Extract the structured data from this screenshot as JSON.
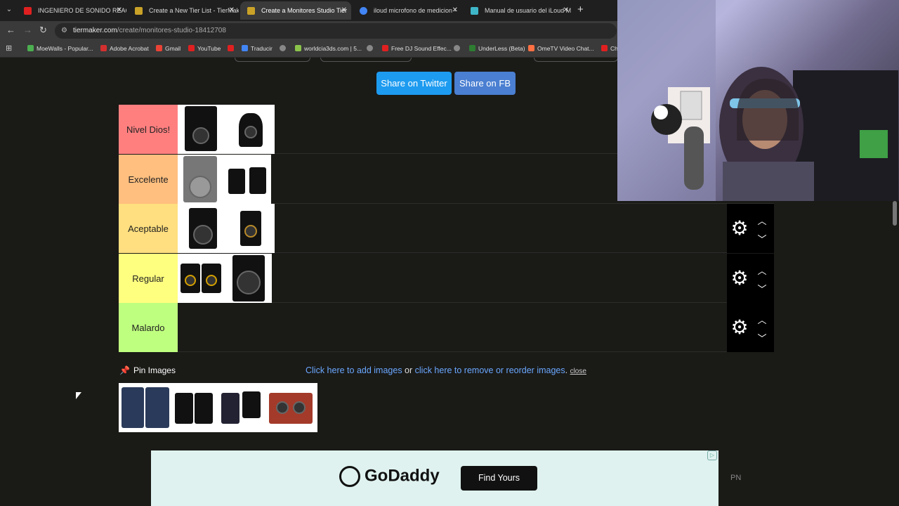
{
  "browser": {
    "tabs": [
      {
        "title": "INGENIERO DE SONIDO REACC",
        "color": "#e02020"
      },
      {
        "title": "Create a New Tier List - TierMak",
        "color": "#c9a227"
      },
      {
        "title": "Create a Monitores Studio Tier",
        "color": "#c9a227"
      },
      {
        "title": "iloud microfono de medicion -",
        "color": "#4285f4"
      },
      {
        "title": "Manual de usuario del iLoud M",
        "color": "#3fb6c8"
      }
    ],
    "url_host": "tiermaker.com",
    "url_path": "/create/monitores-studio-18412708",
    "bookmarks": [
      {
        "label": "MoeWalls - Popular...",
        "color": "#4caf50"
      },
      {
        "label": "Adobe Acrobat",
        "color": "#d32f2f"
      },
      {
        "label": "Gmail",
        "color": "#ea4335"
      },
      {
        "label": "YouTube",
        "color": "#e02020"
      },
      {
        "label": "",
        "color": "#e02020"
      },
      {
        "label": "Traducir",
        "color": "#4285f4"
      },
      {
        "label": "",
        "color": "#888888"
      },
      {
        "label": "worldcia3ds.com | 5...",
        "color": "#8bc34a"
      },
      {
        "label": "",
        "color": "#888888"
      },
      {
        "label": "Free DJ Sound Effec...",
        "color": "#e02020"
      },
      {
        "label": "",
        "color": "#888888"
      },
      {
        "label": "UnderLess (Beta)",
        "color": "#2e7d32"
      },
      {
        "label": "OmeTV Video Chat...",
        "color": "#ff7043"
      },
      {
        "label": "Ch",
        "color": "#e02020"
      }
    ]
  },
  "share": {
    "twitter": "Share on Twitter",
    "twitter_color": "#1d9bf0",
    "fb": "Share on FB",
    "fb_color": "#4a7fd1"
  },
  "tiers": [
    {
      "label": "Nivel Dios!",
      "color": "#ff7f7f",
      "items": 2
    },
    {
      "label": "Excelente",
      "color": "#ffbf7f",
      "items": 2
    },
    {
      "label": "Aceptable",
      "color": "#ffdf7f",
      "items": 2
    },
    {
      "label": "Regular",
      "color": "#ffff7f",
      "items": 2
    },
    {
      "label": "Malardo",
      "color": "#bfff7f",
      "items": 0
    }
  ],
  "pin": {
    "label": "Pin Images"
  },
  "links": {
    "add": "Click here to add images",
    "or": " or ",
    "remove": "click here to remove or reorder images",
    "dot": ". ",
    "close": "close"
  },
  "ad": {
    "brand": "GoDaddy",
    "cta": "Find Yours",
    "pn": "PN"
  }
}
